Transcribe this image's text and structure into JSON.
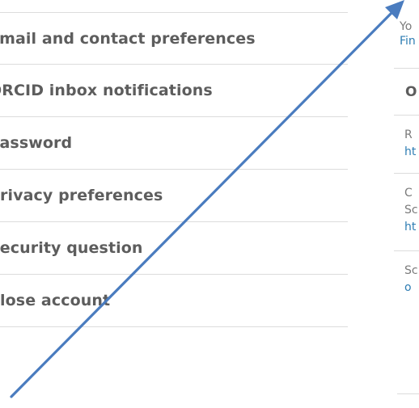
{
  "menu": {
    "items": [
      {
        "label": "Email and contact preferences"
      },
      {
        "label": "ORCID inbox notifications"
      },
      {
        "label": "Password"
      },
      {
        "label": "Privacy preferences"
      },
      {
        "label": "Security question"
      },
      {
        "label": "Close account"
      }
    ]
  },
  "right": {
    "intro_text": "Yo",
    "intro_link": "Fin",
    "panel_title": "O",
    "entries": [
      {
        "text": "R",
        "link": "ht"
      },
      {
        "text": "C",
        "text2": "Sc",
        "link": "ht"
      },
      {
        "text": "Sc",
        "link": "o"
      }
    ]
  },
  "colors": {
    "menu_text": "#5d5d5d",
    "divider": "#dcdcdc",
    "link": "#2e7db3",
    "muted": "#7a7a7a",
    "arrow": "#4a7cbf"
  },
  "annotation": {
    "icon": "arrow-icon"
  }
}
